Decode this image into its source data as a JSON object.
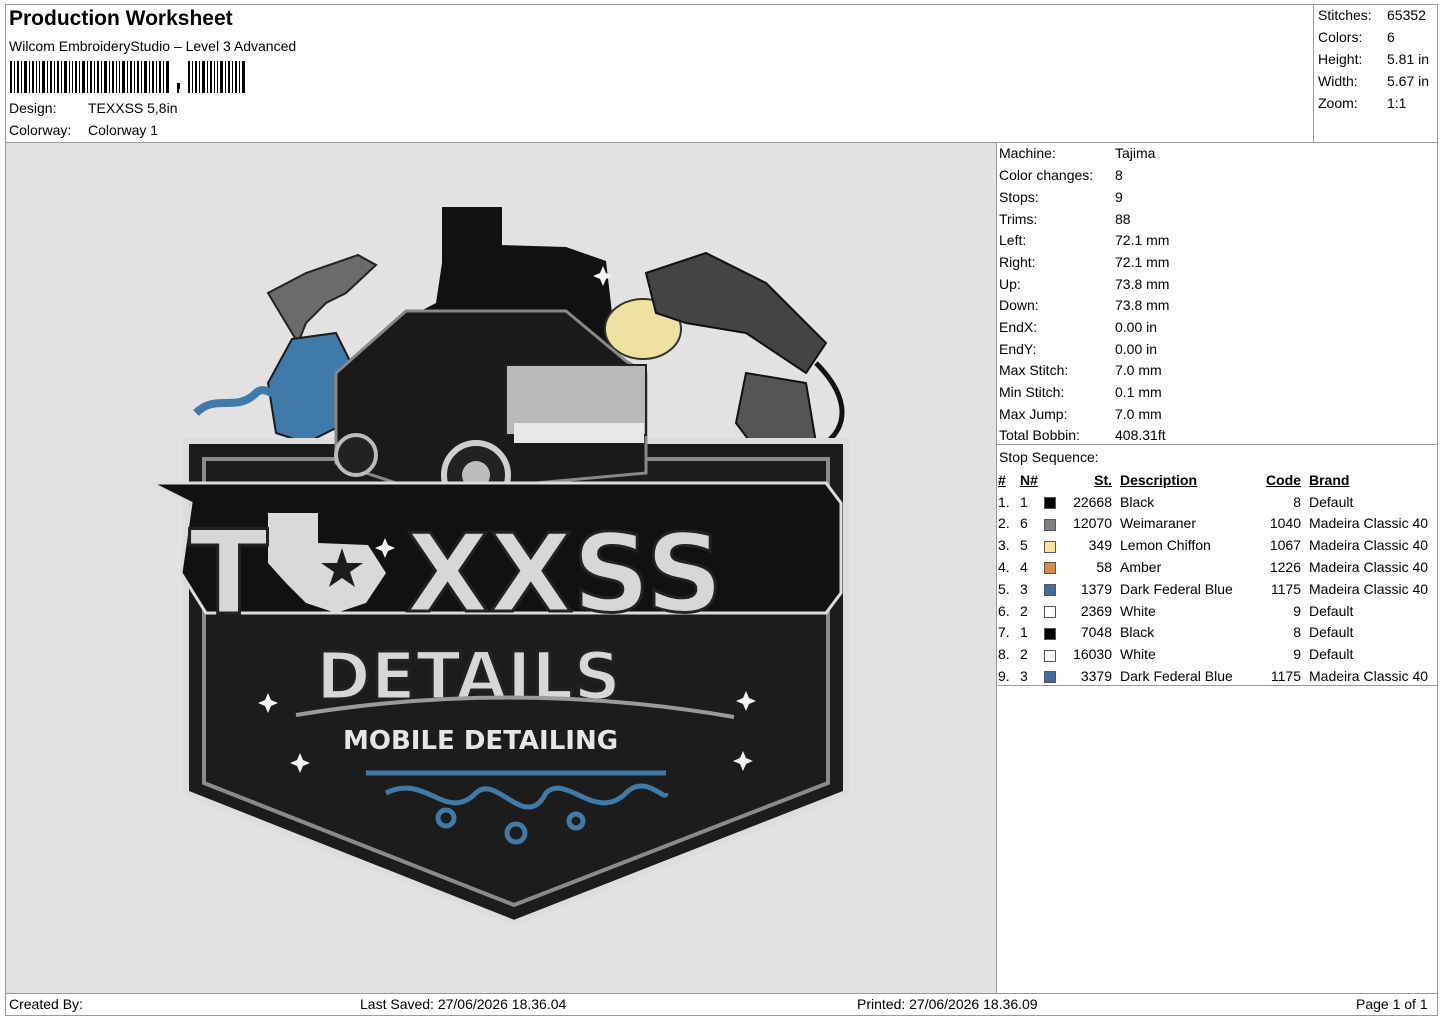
{
  "header": {
    "title": "Production Worksheet",
    "software": "Wilcom EmbroideryStudio – Level 3 Advanced",
    "design_label": "Design:",
    "design_value": "TEXXSS 5,8in",
    "colorway_label": "Colorway:",
    "colorway_value": "Colorway 1"
  },
  "summary": [
    {
      "label": "Stitches:",
      "value": "65352"
    },
    {
      "label": "Colors:",
      "value": "6"
    },
    {
      "label": "Height:",
      "value": "5.81 in"
    },
    {
      "label": "Width:",
      "value": "5.67 in"
    },
    {
      "label": "Zoom:",
      "value": "1:1"
    }
  ],
  "machine_info": [
    {
      "label": "Machine:",
      "value": "Tajima"
    },
    {
      "label": "Color changes:",
      "value": "8"
    },
    {
      "label": "Stops:",
      "value": "9"
    },
    {
      "label": "Trims:",
      "value": "88"
    },
    {
      "label": "Left:",
      "value": "72.1 mm"
    },
    {
      "label": "Right:",
      "value": "72.1 mm"
    },
    {
      "label": "Up:",
      "value": "73.8 mm"
    },
    {
      "label": "Down:",
      "value": "73.8 mm"
    },
    {
      "label": "EndX:",
      "value": "0.00 in"
    },
    {
      "label": "EndY:",
      "value": "0.00 in"
    },
    {
      "label": "Max Stitch:",
      "value": "7.0 mm"
    },
    {
      "label": "Min Stitch:",
      "value": "0.1 mm"
    },
    {
      "label": "Max Jump:",
      "value": "7.0 mm"
    },
    {
      "label": "Total Bobbin:",
      "value": "408.31ft"
    }
  ],
  "stop_sequence": {
    "heading": "Stop Sequence:",
    "columns": {
      "num": "#",
      "n": "N#",
      "st": "St.",
      "desc": "Description",
      "code": "Code",
      "brand": "Brand"
    },
    "rows": [
      {
        "num": "1.",
        "n": "1",
        "color": "#000000",
        "st": "22668",
        "desc": "Black",
        "code": "8",
        "brand": "Default"
      },
      {
        "num": "2.",
        "n": "6",
        "color": "#808080",
        "st": "12070",
        "desc": "Weimaraner",
        "code": "1040",
        "brand": "Madeira Classic 40"
      },
      {
        "num": "3.",
        "n": "5",
        "color": "#f7e39a",
        "st": "349",
        "desc": "Lemon Chiffon",
        "code": "1067",
        "brand": "Madeira Classic 40"
      },
      {
        "num": "4.",
        "n": "4",
        "color": "#d98b4a",
        "st": "58",
        "desc": "Amber",
        "code": "1226",
        "brand": "Madeira Classic 40"
      },
      {
        "num": "5.",
        "n": "3",
        "color": "#3d6ea0",
        "st": "1379",
        "desc": "Dark Federal Blue",
        "code": "1175",
        "brand": "Madeira Classic 40"
      },
      {
        "num": "6.",
        "n": "2",
        "color": "#ffffff",
        "st": "2369",
        "desc": "White",
        "code": "9",
        "brand": "Default"
      },
      {
        "num": "7.",
        "n": "1",
        "color": "#000000",
        "st": "7048",
        "desc": "Black",
        "code": "8",
        "brand": "Default"
      },
      {
        "num": "8.",
        "n": "2",
        "color": "#ffffff",
        "st": "16030",
        "desc": "White",
        "code": "9",
        "brand": "Default"
      },
      {
        "num": "9.",
        "n": "3",
        "color": "#3d6ea0",
        "st": "3379",
        "desc": "Dark Federal Blue",
        "code": "1175",
        "brand": "Madeira Classic 40"
      }
    ]
  },
  "design": {
    "logo_word": "T  XXSS",
    "logo_sub": "DETAILS",
    "logo_tagline": "MOBILE DETAILING"
  },
  "footer": {
    "created_by": "Created By:",
    "last_saved": "Last Saved: 27/06/2026 18.36.04",
    "printed": "Printed: 27/06/2026 18.36.09",
    "page": "Page 1 of 1"
  }
}
